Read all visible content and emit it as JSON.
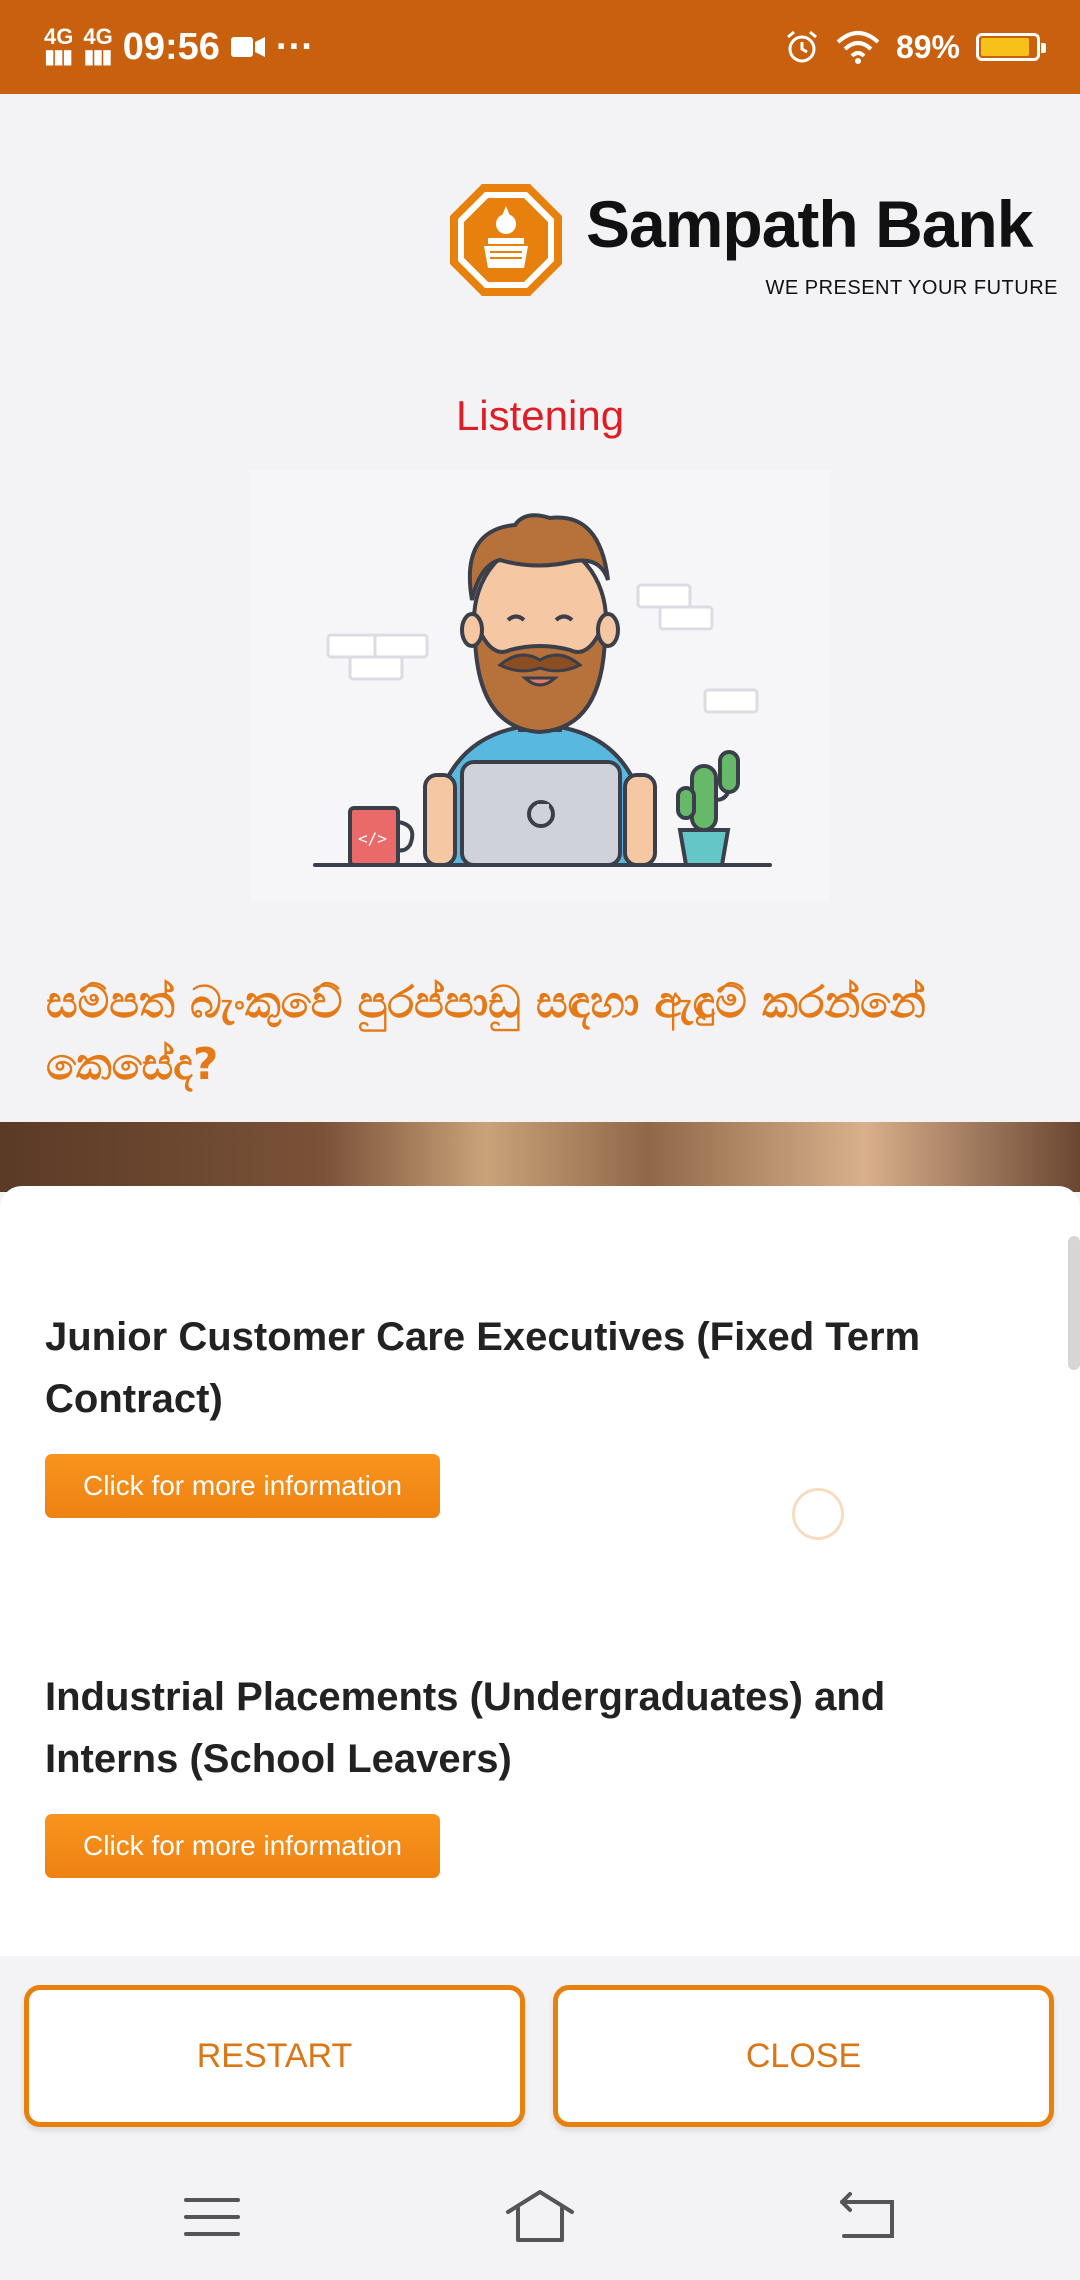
{
  "status_bar": {
    "network1": "4G",
    "network2": "4G",
    "time": "09:56",
    "more": "···",
    "battery": "89%",
    "battery_level": 0.89
  },
  "brand": {
    "name": "Sampath Bank",
    "tagline": "WE PRESENT YOUR FUTURE",
    "color": "#e8800e"
  },
  "voice_status": "Listening",
  "question": "සම්පත් බැංකුවේ පුරප්පාඩු සඳහා ඇඳුම් කරන්නේ කෙසේද?",
  "jobs": [
    {
      "title": "Junior Customer Care Executives (Fixed Term Contract)",
      "button_label": "Click for more information"
    },
    {
      "title": "Industrial Placements (Undergraduates) and Interns (School Leavers)",
      "button_label": "Click for more information"
    }
  ],
  "actions": {
    "restart": "RESTART",
    "close": "CLOSE"
  },
  "colors": {
    "status_bar": "#c9600d",
    "accent": "#f8951d",
    "listening": "#e01c24"
  }
}
